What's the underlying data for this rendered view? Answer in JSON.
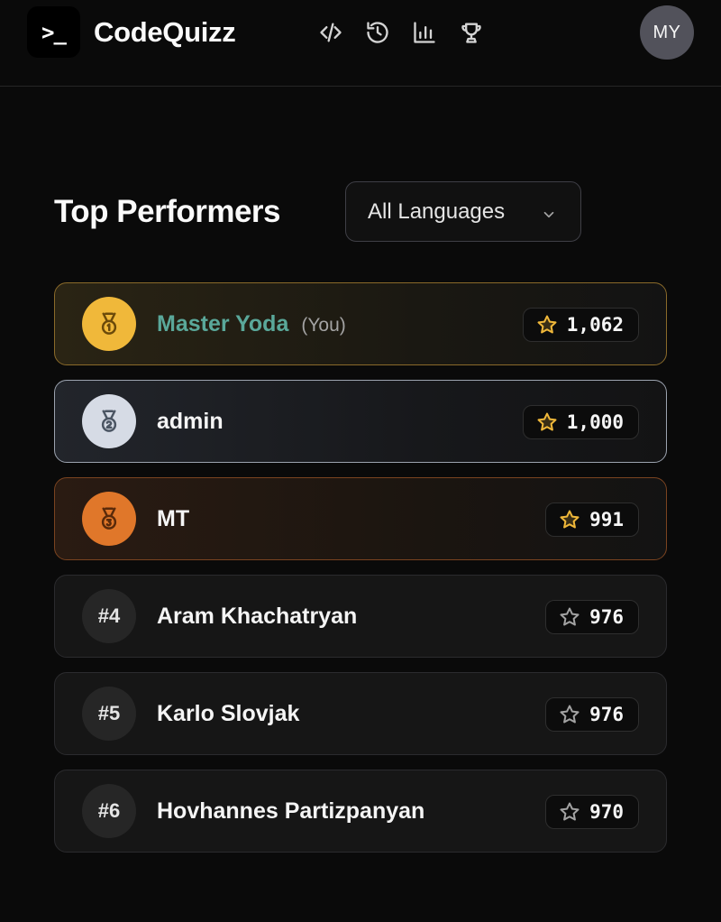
{
  "header": {
    "logo_glyph": ">_",
    "brand": "CodeQuizz",
    "nav": [
      "code-icon",
      "history-icon",
      "chart-icon",
      "trophy-icon"
    ],
    "avatar_initials": "MY"
  },
  "main": {
    "title": "Top Performers",
    "language_filter": "All Languages"
  },
  "leaderboard": [
    {
      "rank": 1,
      "tier": "gold",
      "name": "Master Yoda",
      "tag": "(You)",
      "score": "1,062"
    },
    {
      "rank": 2,
      "tier": "silver",
      "name": "admin",
      "tag": "",
      "score": "1,000"
    },
    {
      "rank": 3,
      "tier": "bronze",
      "name": "MT",
      "tag": "",
      "score": "991"
    },
    {
      "rank": 4,
      "tier": "rank",
      "rank_label": "#4",
      "name": "Aram Khachatryan",
      "tag": "",
      "score": "976"
    },
    {
      "rank": 5,
      "tier": "rank",
      "rank_label": "#5",
      "name": "Karlo Slovjak",
      "tag": "",
      "score": "976"
    },
    {
      "rank": 6,
      "tier": "rank",
      "rank_label": "#6",
      "name": "Hovhannes Partizpanyan",
      "tag": "",
      "score": "970"
    }
  ],
  "colors": {
    "gold": "#f0b83a",
    "silver": "#d6dbe5",
    "bronze": "#e0772a",
    "current_user_name": "#5aa89a"
  }
}
